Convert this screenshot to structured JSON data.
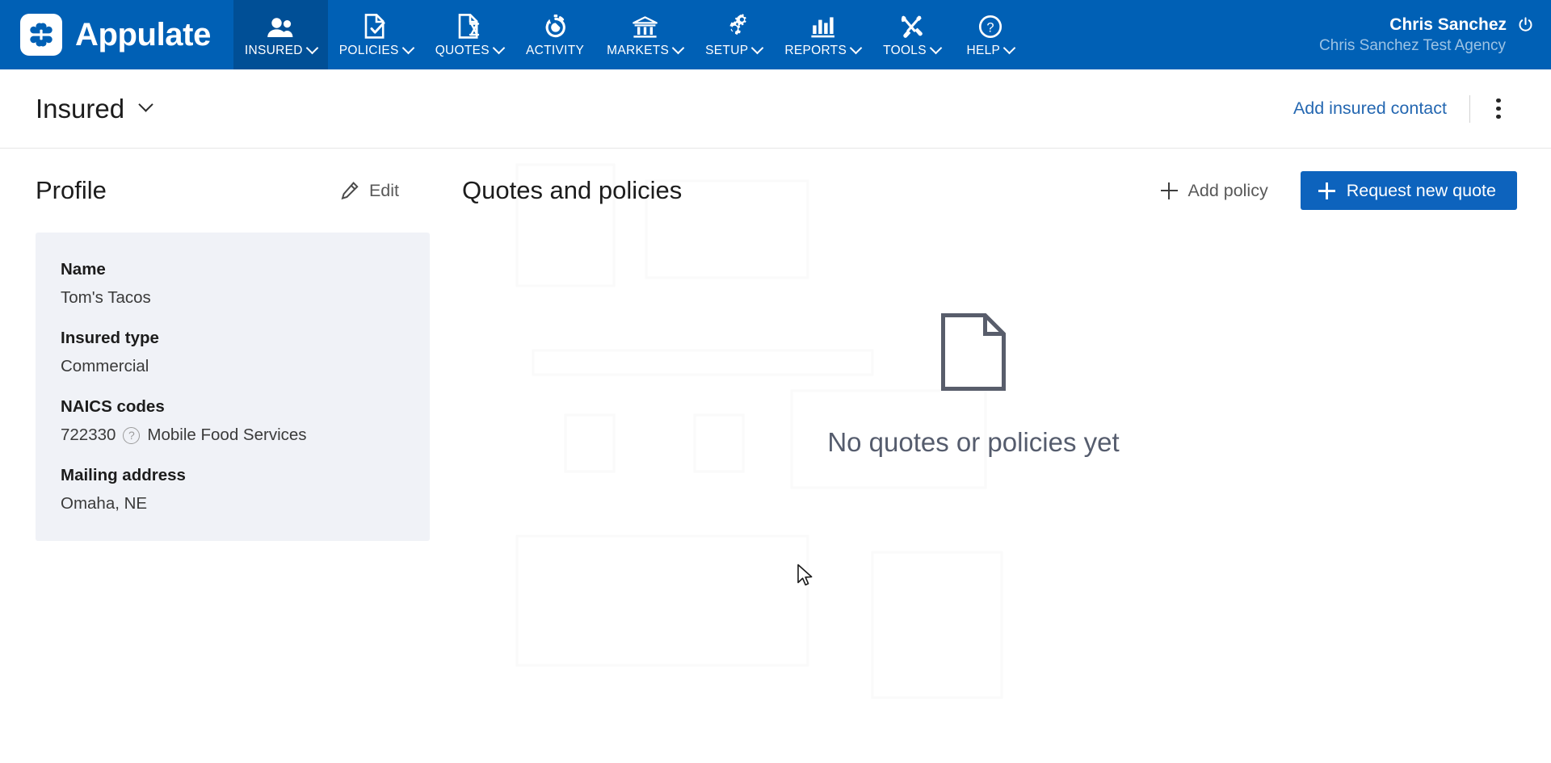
{
  "brand": {
    "name": "Appulate",
    "logo_icon": "clover-logo-icon"
  },
  "topnav": {
    "items": [
      {
        "label": "INSURED",
        "icon": "people-icon",
        "caret": true,
        "active": true
      },
      {
        "label": "POLICIES",
        "icon": "document-check-icon",
        "caret": true,
        "active": false
      },
      {
        "label": "QUOTES",
        "icon": "document-hourglass-icon",
        "caret": true,
        "active": false
      },
      {
        "label": "ACTIVITY",
        "icon": "stopwatch-icon",
        "caret": false,
        "active": false
      },
      {
        "label": "MARKETS",
        "icon": "bank-icon",
        "caret": true,
        "active": false
      },
      {
        "label": "SETUP",
        "icon": "gears-icon",
        "caret": true,
        "active": false
      },
      {
        "label": "REPORTS",
        "icon": "bar-chart-icon",
        "caret": true,
        "active": false
      },
      {
        "label": "TOOLS",
        "icon": "wrench-screwdriver-icon",
        "caret": true,
        "active": false
      },
      {
        "label": "HELP",
        "icon": "question-circle-icon",
        "caret": true,
        "active": false
      }
    ]
  },
  "account": {
    "name": "Chris Sanchez",
    "agency": "Chris Sanchez Test Agency",
    "power_icon": "power-icon"
  },
  "subheader": {
    "title": "Insured",
    "dropdown_icon": "chevron-down-icon",
    "add_contact_label": "Add insured contact",
    "kebab_icon": "more-vertical-icon"
  },
  "profile": {
    "title": "Profile",
    "edit_label": "Edit",
    "edit_icon": "pencil-icon",
    "fields": [
      {
        "label": "Name",
        "value": "Tom's Tacos"
      },
      {
        "label": "Insured type",
        "value": "Commercial"
      },
      {
        "label": "NAICS codes",
        "value": "722330",
        "help_icon": "question-circle-icon",
        "description": "Mobile Food Services"
      },
      {
        "label": "Mailing address",
        "value": "Omaha, NE"
      }
    ]
  },
  "quotes_panel": {
    "title": "Quotes and policies",
    "add_policy_label": "Add policy",
    "request_quote_label": "Request new quote",
    "empty_icon": "document-outline-icon",
    "empty_message": "No quotes or policies yet"
  },
  "colors": {
    "brand_blue": "#0060b5",
    "nav_active_blue": "#004f96",
    "primary_button": "#0d63bd",
    "link_blue": "#2467b1",
    "card_background": "#f0f2f7",
    "empty_text": "#555c6d"
  }
}
